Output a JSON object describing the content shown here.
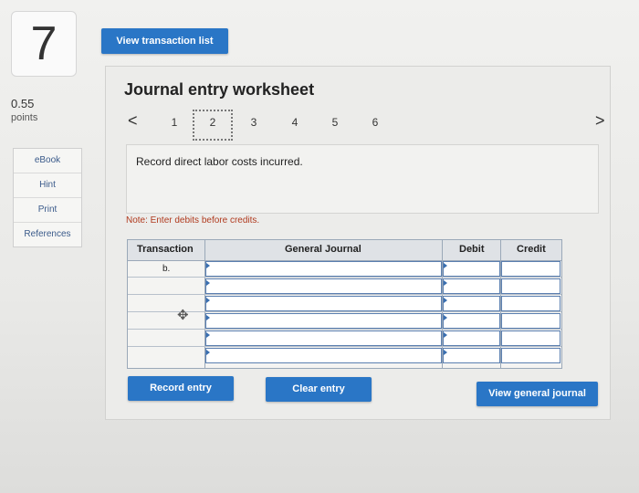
{
  "question": {
    "number": "7",
    "points_value": "0.55",
    "points_label": "points"
  },
  "sidebar": {
    "items": [
      {
        "label": "eBook"
      },
      {
        "label": "Hint"
      },
      {
        "label": "Print"
      },
      {
        "label": "References"
      }
    ]
  },
  "toolbar": {
    "view_transaction_list": "View transaction list"
  },
  "worksheet": {
    "title": "Journal entry worksheet",
    "pager": {
      "prev_symbol": "<",
      "next_symbol": ">",
      "pages": [
        "1",
        "2",
        "3",
        "4",
        "5",
        "6"
      ],
      "active_page": "2"
    },
    "description": "Record direct labor costs incurred.",
    "note": "Note: Enter debits before credits.",
    "table": {
      "headers": {
        "transaction": "Transaction",
        "general_journal": "General Journal",
        "debit": "Debit",
        "credit": "Credit"
      },
      "first_transaction_label": "b."
    },
    "buttons": {
      "record_entry": "Record entry",
      "clear_entry": "Clear entry",
      "view_general_journal": "View general journal"
    }
  },
  "colors": {
    "button_blue": "#2a76c6",
    "note_red": "#b03a1e",
    "link_blue": "#3a5a8a"
  }
}
